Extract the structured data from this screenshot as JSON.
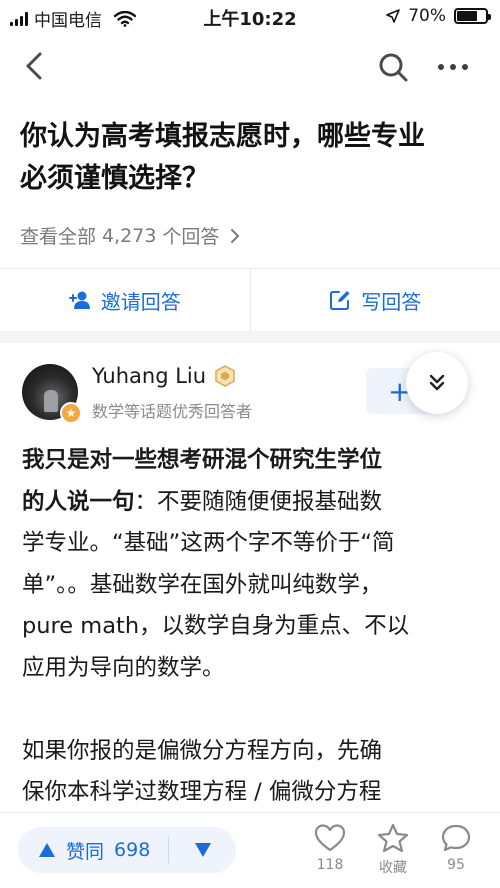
{
  "status_bar": {
    "carrier": "中国电信",
    "time": "上午10:22",
    "battery_percent": "70%",
    "battery_level": 0.7
  },
  "question": {
    "title_line1": "你认为高考填报志愿时，哪些专业",
    "title_line2": "必须谨慎选择？",
    "view_all_prefix": "查看全部",
    "answer_count": "4,273",
    "view_all_suffix": "个回答"
  },
  "actions": {
    "invite_label": "邀请回答",
    "write_label": "写回答"
  },
  "answer": {
    "author_name": "Yuhang Liu",
    "author_desc": "数学等话题优秀回答者",
    "follow_symbol": "+",
    "avatar_badge_symbol": "★",
    "lines": [
      {
        "text": "我只是对一些想考研混个研究生学位",
        "strong": true
      },
      {
        "text": "的人说一句：不要随随便便报基础数",
        "strong": false,
        "strong_prefix": "的人说一句"
      },
      {
        "text": "学专业。“基础”这两个字不等价于“简",
        "strong": false
      },
      {
        "text": "单”。。基础数学在国外就叫纯数学，",
        "strong": false
      },
      {
        "text": "pure math，以数学自身为重点、不以",
        "strong": false
      },
      {
        "text": "应用为导向的数学。",
        "strong": false
      },
      {
        "text": "",
        "strong": false
      },
      {
        "text": "如果你报的是偏微分方程方向，先确",
        "strong": false
      },
      {
        "text": "保你本科学过数理方程 / 偏微分方程",
        "strong": false
      }
    ]
  },
  "bottom_bar": {
    "vote_label": "赞同",
    "vote_count": "698",
    "like_count": "118",
    "collect_label": "收藏",
    "comment_count": "95"
  },
  "colors": {
    "accent": "#1a6cd8",
    "muted": "#8a8a8a",
    "badge": "#f2a83a"
  },
  "icons": [
    "back-icon",
    "search-icon",
    "more-icon",
    "invite-icon",
    "edit-icon",
    "medal-icon",
    "chevron-double-down-icon",
    "upvote-icon",
    "downvote-icon",
    "heart-icon",
    "star-icon",
    "comment-icon"
  ]
}
